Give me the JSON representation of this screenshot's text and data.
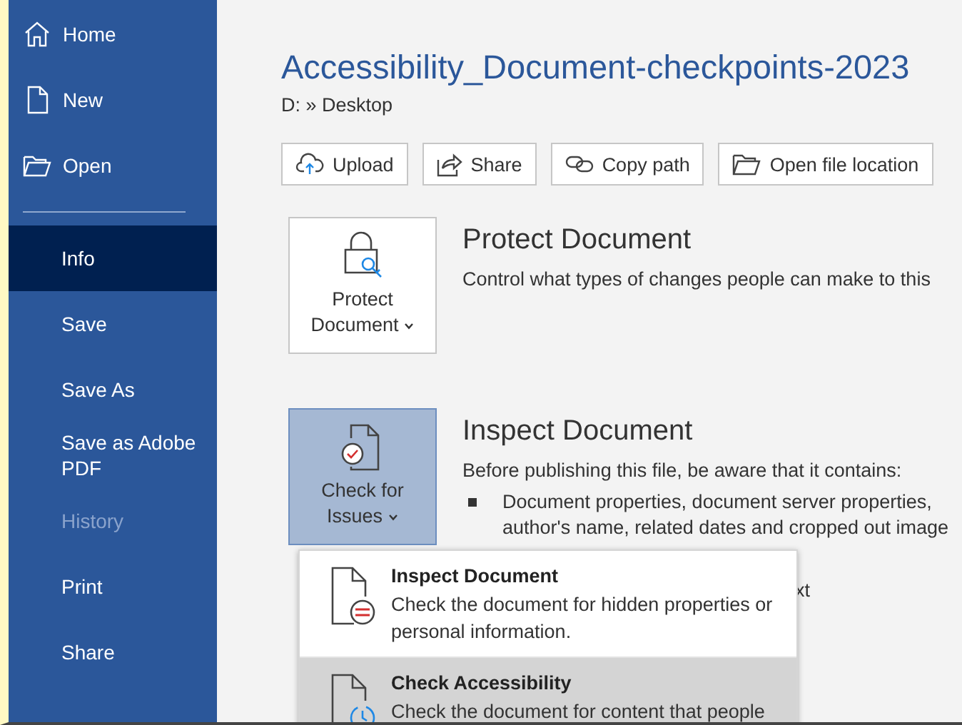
{
  "sidebar": {
    "items": [
      {
        "label": "Home",
        "selected": false,
        "disabled": false
      },
      {
        "label": "New",
        "selected": false,
        "disabled": false
      },
      {
        "label": "Open",
        "selected": false,
        "disabled": false
      },
      {
        "label": "Info",
        "selected": true,
        "disabled": false
      },
      {
        "label": "Save",
        "selected": false,
        "disabled": false
      },
      {
        "label": "Save As",
        "selected": false,
        "disabled": false
      },
      {
        "label": "Save as Adobe PDF",
        "selected": false,
        "disabled": false
      },
      {
        "label": "History",
        "selected": false,
        "disabled": true
      },
      {
        "label": "Print",
        "selected": false,
        "disabled": false
      },
      {
        "label": "Share",
        "selected": false,
        "disabled": false
      }
    ]
  },
  "document": {
    "title": "Accessibility_Document-checkpoints-2023",
    "path": "D: » Desktop"
  },
  "actions": [
    {
      "label": "Upload"
    },
    {
      "label": "Share"
    },
    {
      "label": "Copy path"
    },
    {
      "label": "Open file location"
    }
  ],
  "sections": [
    {
      "button": "Protect Document",
      "selected": false,
      "heading": "Protect Document",
      "text": "Control what types of changes people can make to this"
    },
    {
      "button": "Check for Issues",
      "selected": true,
      "heading": "Inspect Document",
      "text": "Before publishing this file, be aware that it contains:",
      "bullets": [
        {
          "lines": [
            "Document properties, document server properties,",
            "author's name, related dates and cropped out image"
          ]
        },
        {
          "lines": [
            "xt"
          ]
        }
      ]
    }
  ],
  "menu": {
    "items": [
      {
        "title": "Inspect Document",
        "description": "Check the document for hidden properties or personal information.",
        "selected": false
      },
      {
        "title": "Check Accessibility",
        "description": "Check the document for content that people",
        "selected": true
      }
    ]
  }
}
